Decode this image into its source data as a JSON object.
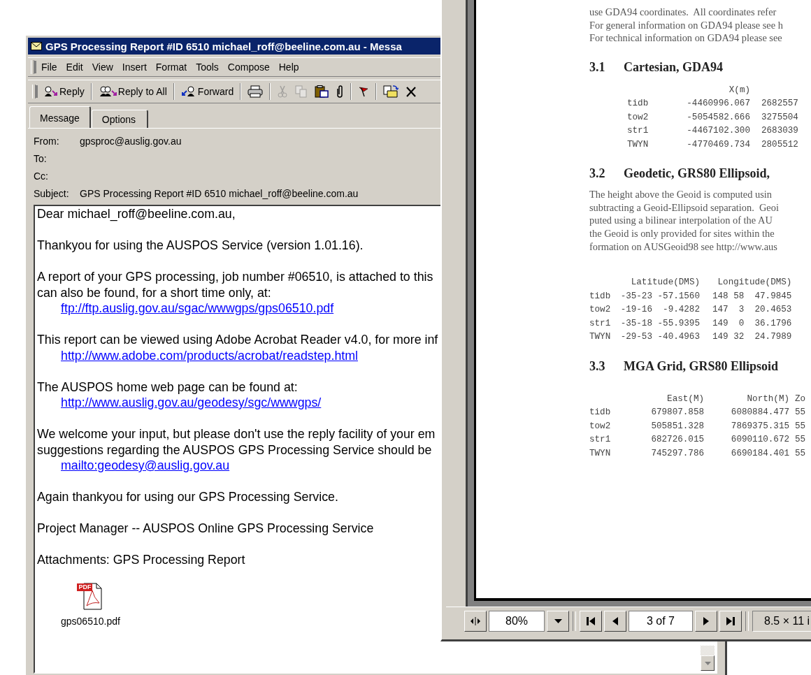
{
  "mail_window": {
    "title": "GPS Processing Report #ID 6510 michael_roff@beeline.com.au - Messa",
    "menu": [
      "File",
      "Edit",
      "View",
      "Insert",
      "Format",
      "Tools",
      "Compose",
      "Help"
    ],
    "toolbar": [
      [
        {
          "kind": "reply",
          "label": "Reply",
          "disabled": false
        }
      ],
      [
        {
          "kind": "reply-all",
          "label": "Reply to All",
          "disabled": false
        }
      ],
      [
        {
          "kind": "forward",
          "label": "Forward",
          "disabled": false
        }
      ],
      [
        {
          "kind": "print",
          "disabled": false
        }
      ],
      [
        {
          "kind": "cut",
          "disabled": true
        },
        {
          "kind": "copy",
          "disabled": true
        },
        {
          "kind": "paste",
          "disabled": false
        },
        {
          "kind": "attach",
          "disabled": false
        }
      ],
      [
        {
          "kind": "flag",
          "disabled": false
        }
      ],
      [
        {
          "kind": "move",
          "disabled": false
        },
        {
          "kind": "delete",
          "disabled": false
        }
      ]
    ],
    "tabs": [
      {
        "label": "Message",
        "selected": true
      },
      {
        "label": "Options",
        "selected": false
      }
    ],
    "headers": [
      {
        "label": "From:",
        "value": "gpsproc@auslig.gov.au"
      },
      {
        "label": "To:"
      },
      {
        "label": "Cc:"
      },
      {
        "label": "Subject:",
        "value": "GPS Processing Report #ID 6510 michael_roff@beeline.com.au"
      }
    ],
    "body": [
      [
        {
          "kind": "text",
          "text": "Dear michael_roff@beeline.com.au,"
        }
      ],
      [
        {
          "kind": "text",
          "text": "Thankyou for using the AUSPOS Service (version 1.01.16)."
        }
      ],
      [
        {
          "kind": "text",
          "text": "A report of your GPS processing, job number #06510, is attached to this"
        },
        {
          "kind": "text",
          "text": "can also be found, for a short time only, at:"
        },
        {
          "kind": "link",
          "text": "ftp://ftp.auslig.gov.au/sgac/wwwgps/gps06510.pdf"
        }
      ],
      [
        {
          "kind": "text",
          "text": "This report can be viewed using Adobe Acrobat Reader v4.0, for more inf"
        },
        {
          "kind": "link",
          "text": "http://www.adobe.com/products/acrobat/readstep.html"
        }
      ],
      [
        {
          "kind": "text",
          "text": "The AUSPOS home web page can be found at:"
        },
        {
          "kind": "link",
          "text": "http://www.auslig.gov.au/geodesy/sgc/wwwgps/"
        }
      ],
      [
        {
          "kind": "text",
          "text": "We welcome your input, but please don't use the reply facility of your em"
        },
        {
          "kind": "text",
          "text": "suggestions regarding the AUSPOS GPS Processing Service should be"
        },
        {
          "kind": "link",
          "text": "mailto:geodesy@auslig.gov.au"
        }
      ],
      [
        {
          "kind": "text",
          "text": "Again thankyou for using our GPS Processing Service."
        }
      ],
      [
        {
          "kind": "text",
          "text": "Project Manager -- AUSPOS Online GPS Processing Service"
        }
      ]
    ],
    "attachments_label": "Attachments: GPS Processing Report",
    "attachment": {
      "badge": "PDF",
      "name": "gps06510.pdf"
    }
  },
  "pdf_window": {
    "intro": [
      "use GDA94 coordinates.  All coordinates refer",
      "For general information on GDA94 please see h",
      "For technical information on GDA94 please see"
    ],
    "sections": [
      {
        "number": "3.1",
        "title": "Cartesian, GDA94",
        "table": {
          "columns": [
            "",
            "X(m)"
          ],
          "rows": [
            [
              "tidb",
              "-4460996.067",
              "2682557"
            ],
            [
              "tow2",
              "-5054582.666",
              "3275504"
            ],
            [
              "str1",
              "-4467102.300",
              "2683039"
            ],
            [
              "TWYN",
              "-4770469.734",
              "2805512"
            ]
          ]
        }
      },
      {
        "number": "3.2",
        "title": "Geodetic, GRS80 Ellipsoid,",
        "paragraph": [
          "The height above the Geoid is computed usin",
          "subtracting a Geoid-Ellipsoid separation.  Geoi",
          "puted using a bilinear interpolation of the AU",
          "the Geoid is only provided for sites within the",
          "formation on AUSGeoid98 see http://www.aus"
        ],
        "table": {
          "columns": [
            "",
            "Latitude(DMS)",
            "Longitude(DMS)"
          ],
          "rows": [
            [
              "tidb",
              "-35-23 -57.1560",
              "148 58  47.9845"
            ],
            [
              "tow2",
              "-19-16  -9.4282",
              "147  3  20.4653"
            ],
            [
              "str1",
              "-35-18 -55.9395",
              "149  0  36.1796"
            ],
            [
              "TWYN",
              "-29-53 -40.4963",
              "149 32  24.7989"
            ]
          ]
        }
      },
      {
        "number": "3.3",
        "title": "MGA Grid, GRS80 Ellipsoid",
        "table": {
          "columns": [
            "",
            "East(M)",
            "North(M)",
            "Zo"
          ],
          "rows": [
            [
              "tidb",
              "679807.858",
              "6080884.477",
              "55"
            ],
            [
              "tow2",
              "505851.328",
              "7869375.315",
              "55"
            ],
            [
              "str1",
              "682726.015",
              "6090110.672",
              "55"
            ],
            [
              "TWYN",
              "745297.786",
              "6690184.401",
              "55"
            ]
          ]
        }
      }
    ],
    "zoom": "80%",
    "page": "3 of 7",
    "page_size": "8.5 × 11 i"
  }
}
